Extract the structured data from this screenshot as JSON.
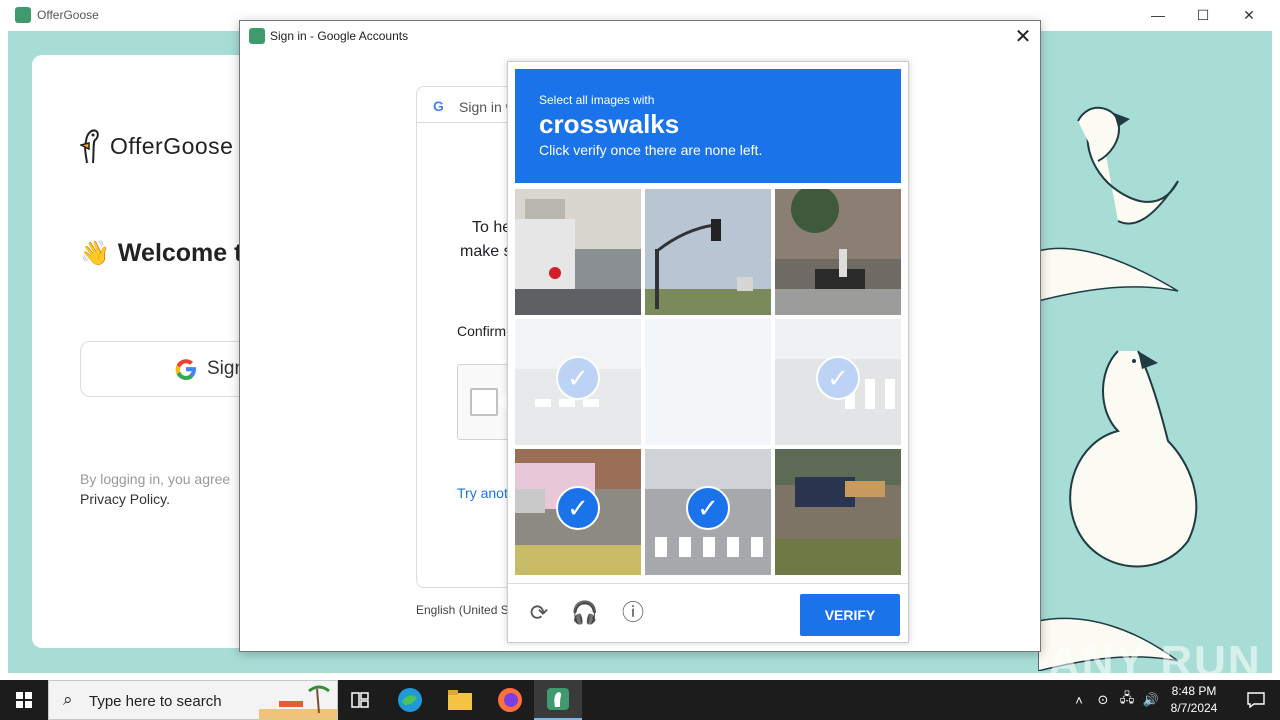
{
  "app": {
    "title": "OfferGoose",
    "brand_name": "OfferGoose",
    "welcome": "Welcome to",
    "google_button": "Sign",
    "legal_line1": "By logging in, you agree",
    "privacy": "Privacy Policy."
  },
  "window_controls": {
    "minimize": "—",
    "maximize": "☐",
    "close": "✕"
  },
  "dialog": {
    "title": "Sign in - Google Accounts",
    "close": "✕",
    "header_label": "Sign in w",
    "text_line1": "To he",
    "text_line2": "make s",
    "confirm_label": "Confirm",
    "try_another": "Try anot",
    "language": "English (United S"
  },
  "challenge": {
    "pre_text": "Select all images with",
    "target": "crosswalks",
    "sub_text": "Click verify once there are none left.",
    "verify_label": "VERIFY",
    "tiles": [
      {
        "scene": "truck-street",
        "state": "normal",
        "selected": false
      },
      {
        "scene": "traffic-light",
        "state": "normal",
        "selected": false
      },
      {
        "scene": "motorbikes",
        "state": "normal",
        "selected": false
      },
      {
        "scene": "crosswalk-faded",
        "state": "faded",
        "selected": true
      },
      {
        "scene": "blank",
        "state": "blank",
        "selected": false
      },
      {
        "scene": "crosswalk-faded",
        "state": "faded",
        "selected": true
      },
      {
        "scene": "bus-street",
        "state": "normal",
        "selected": true
      },
      {
        "scene": "crosswalk-street",
        "state": "normal",
        "selected": true
      },
      {
        "scene": "motorbike-road",
        "state": "normal",
        "selected": false
      }
    ]
  },
  "taskbar": {
    "search_placeholder": "Type here to search",
    "time": "8:48 PM",
    "date": "8/7/2024"
  },
  "watermark": "ANY RUN",
  "colors": {
    "teal_bg": "#a8ddd6",
    "accent_blue": "#1a73e8",
    "goose_green": "#3f9a6d"
  }
}
